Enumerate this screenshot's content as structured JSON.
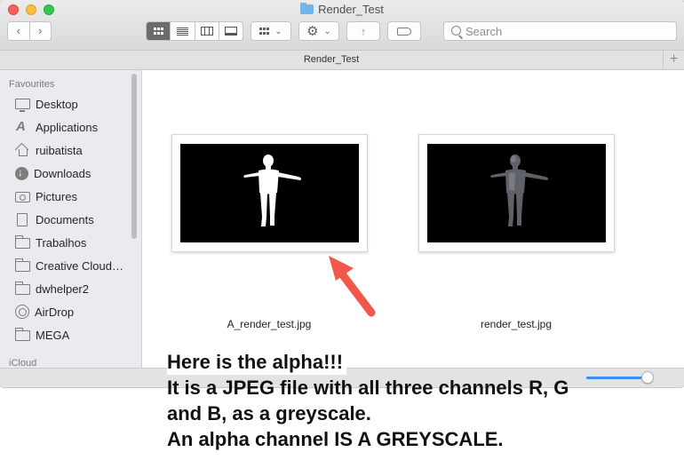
{
  "window": {
    "title": "Render_Test",
    "path_tab": "Render_Test",
    "add_tab": "+"
  },
  "toolbar": {
    "back": "‹",
    "forward": "›",
    "arrange_caret": "⌄",
    "action_caret": "⌄",
    "share": "↑",
    "search_placeholder": "Search"
  },
  "icons": {
    "back": "chevron-left-icon",
    "forward": "chevron-right-icon",
    "view_icon": "icon-view-icon",
    "view_list": "list-view-icon",
    "view_columns": "column-view-icon",
    "view_gallery": "cover-flow-icon",
    "arrange": "arrange-icon",
    "action": "gear-icon",
    "share": "share-icon",
    "tag": "tag-icon",
    "search": "search-icon"
  },
  "sidebar": {
    "favourites_heading": "Favourites",
    "icloud_heading": "iCloud",
    "items": [
      {
        "label": "Desktop",
        "icon": "desktop-icon"
      },
      {
        "label": "Applications",
        "icon": "applications-icon"
      },
      {
        "label": "ruibatista",
        "icon": "home-icon"
      },
      {
        "label": "Downloads",
        "icon": "downloads-icon"
      },
      {
        "label": "Pictures",
        "icon": "pictures-icon"
      },
      {
        "label": "Documents",
        "icon": "documents-icon"
      },
      {
        "label": "Trabalhos",
        "icon": "folder-icon"
      },
      {
        "label": "Creative Cloud…",
        "icon": "folder-icon"
      },
      {
        "label": "dwhelper2",
        "icon": "folder-icon"
      },
      {
        "label": "AirDrop",
        "icon": "airdrop-icon"
      },
      {
        "label": "MEGA",
        "icon": "folder-icon"
      }
    ]
  },
  "files": [
    {
      "name": "A_render_test.jpg",
      "style": "white-silhouette"
    },
    {
      "name": "render_test.jpg",
      "style": "grey-render"
    }
  ],
  "zoom": {
    "level": 0.85
  },
  "annotation": {
    "line1": "Here is the alpha!!!",
    "line2": "It is a JPEG file with all three channels R, G",
    "line3": "and B, as a greyscale.",
    "line4": "An alpha channel IS A GREYSCALE."
  },
  "colors": {
    "arrow": "#f0594a",
    "selected_view": "#6b6b6b",
    "zoom_fill": "#3d8ef7"
  }
}
